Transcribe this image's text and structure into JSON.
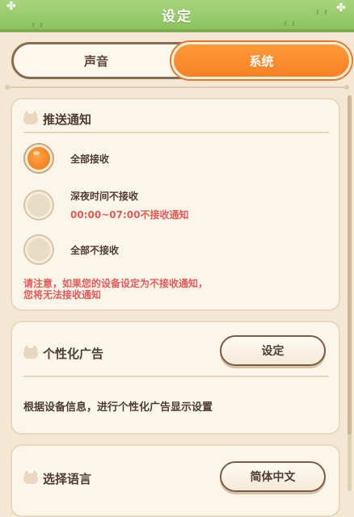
{
  "header": {
    "title": "设定"
  },
  "tabs": [
    {
      "label": "声音",
      "selected": false
    },
    {
      "label": "系统",
      "selected": true
    }
  ],
  "push_notification": {
    "title": "推送通知",
    "options": [
      {
        "label": "全部接收",
        "note": "",
        "selected": true
      },
      {
        "label": "深夜时间不接收",
        "note": "00:00~07:00不接收通知",
        "selected": false
      },
      {
        "label": "全部不接收",
        "note": "",
        "selected": false
      }
    ],
    "warning_line1": "请注意，如果您的设备设定为不接收通知，",
    "warning_line2": "您将无法接收通知"
  },
  "personalized_ads": {
    "title": "个性化广告",
    "button_label": "设定",
    "description": "根据设备信息，进行个性化广告显示设置"
  },
  "language": {
    "title": "选择语言",
    "button_label": "简体中文"
  },
  "colors": {
    "accent": "#f7801f",
    "header_green": "#8cc25e",
    "warning_red": "#e65a5a",
    "background": "#f4e8d4"
  }
}
